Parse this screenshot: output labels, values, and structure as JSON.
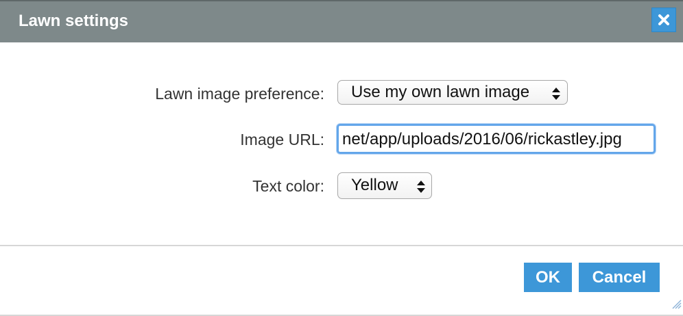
{
  "dialog": {
    "title": "Lawn settings",
    "close_icon": "close-icon"
  },
  "form": {
    "lawn_preference": {
      "label": "Lawn image preference:",
      "value": "Use my own lawn image"
    },
    "image_url": {
      "label": "Image URL:",
      "value": "net/app/uploads/2016/06/rickastley.jpg"
    },
    "text_color": {
      "label": "Text color:",
      "value": "Yellow"
    }
  },
  "buttons": {
    "ok_label": "OK",
    "cancel_label": "Cancel"
  },
  "colors": {
    "titlebar": "#7e898a",
    "accent": "#3d97d8",
    "focus_ring": "#63a6ea"
  }
}
